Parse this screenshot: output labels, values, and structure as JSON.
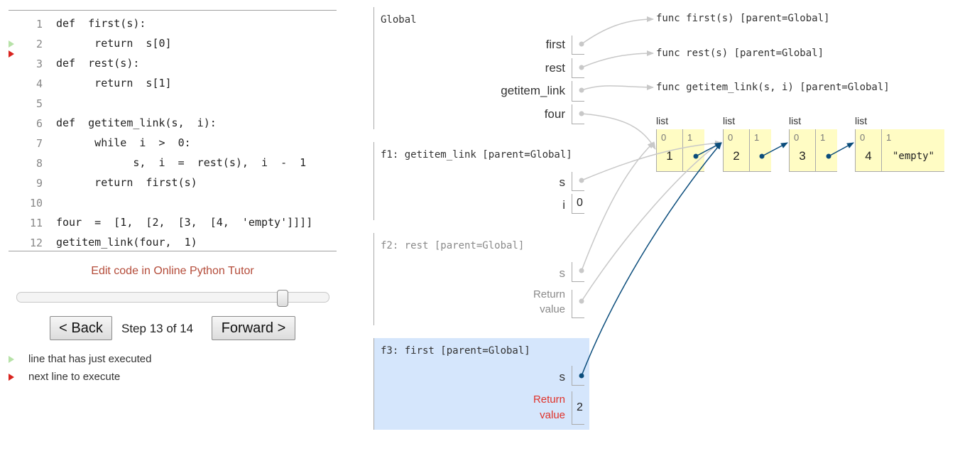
{
  "code": {
    "lines": [
      {
        "n": "1",
        "text": "def  first(s):"
      },
      {
        "n": "2",
        "text": "      return  s[0]"
      },
      {
        "n": "3",
        "text": "def  rest(s):"
      },
      {
        "n": "4",
        "text": "      return  s[1]"
      },
      {
        "n": "5",
        "text": ""
      },
      {
        "n": "6",
        "text": "def  getitem_link(s,  i):"
      },
      {
        "n": "7",
        "text": "      while  i  >  0:"
      },
      {
        "n": "8",
        "text": "            s,  i  =  rest(s),  i  -  1"
      },
      {
        "n": "9",
        "text": "      return  first(s)"
      },
      {
        "n": "10",
        "text": ""
      },
      {
        "n": "11",
        "text": "four  =  [1,  [2,  [3,  [4,  'empty']]]]"
      },
      {
        "n": "12",
        "text": "getitem_link(four,  1)"
      }
    ],
    "prev_line": "2",
    "next_line": "3"
  },
  "controls": {
    "edit_link": "Edit code in Online Python Tutor",
    "back_label": "< Back",
    "step_label": "Step 13 of 14",
    "forward_label": "Forward >",
    "progress": 0.857
  },
  "legend": {
    "prev": "line that has just executed",
    "next": "next line to execute"
  },
  "frames": {
    "global": {
      "title": "Global",
      "vars": [
        "first",
        "rest",
        "getitem_link",
        "four"
      ]
    },
    "f1": {
      "title": "f1: getitem_link [parent=Global]",
      "s_name": "s",
      "i_name": "i",
      "i_value": "0"
    },
    "f2": {
      "title": "f2: rest [parent=Global]",
      "s_name": "s",
      "ret_line1": "Return",
      "ret_line2": "value"
    },
    "f3": {
      "title": "f3: first [parent=Global]",
      "s_name": "s",
      "ret_line1": "Return",
      "ret_line2": "value",
      "ret_value": "2"
    }
  },
  "functions": [
    "func first(s) [parent=Global]",
    "func rest(s) [parent=Global]",
    "func getitem_link(s,  i) [parent=Global]"
  ],
  "lists": [
    {
      "title": "list",
      "idx0": "0",
      "idx1": "1",
      "val0": "1"
    },
    {
      "title": "list",
      "idx0": "0",
      "idx1": "1",
      "val0": "2"
    },
    {
      "title": "list",
      "idx0": "0",
      "idx1": "1",
      "val0": "3"
    },
    {
      "title": "list",
      "idx0": "0",
      "idx1": "1",
      "val0": "4",
      "val1": "\"empty\""
    }
  ],
  "colors": {
    "active_frame": "#d5e6fc",
    "list_bg": "#fffcc4",
    "pointer_active": "#0b4d7c",
    "pointer_dim": "#c8c8c8",
    "return_red": "#e0322a",
    "edit_link": "#b44c3a"
  }
}
